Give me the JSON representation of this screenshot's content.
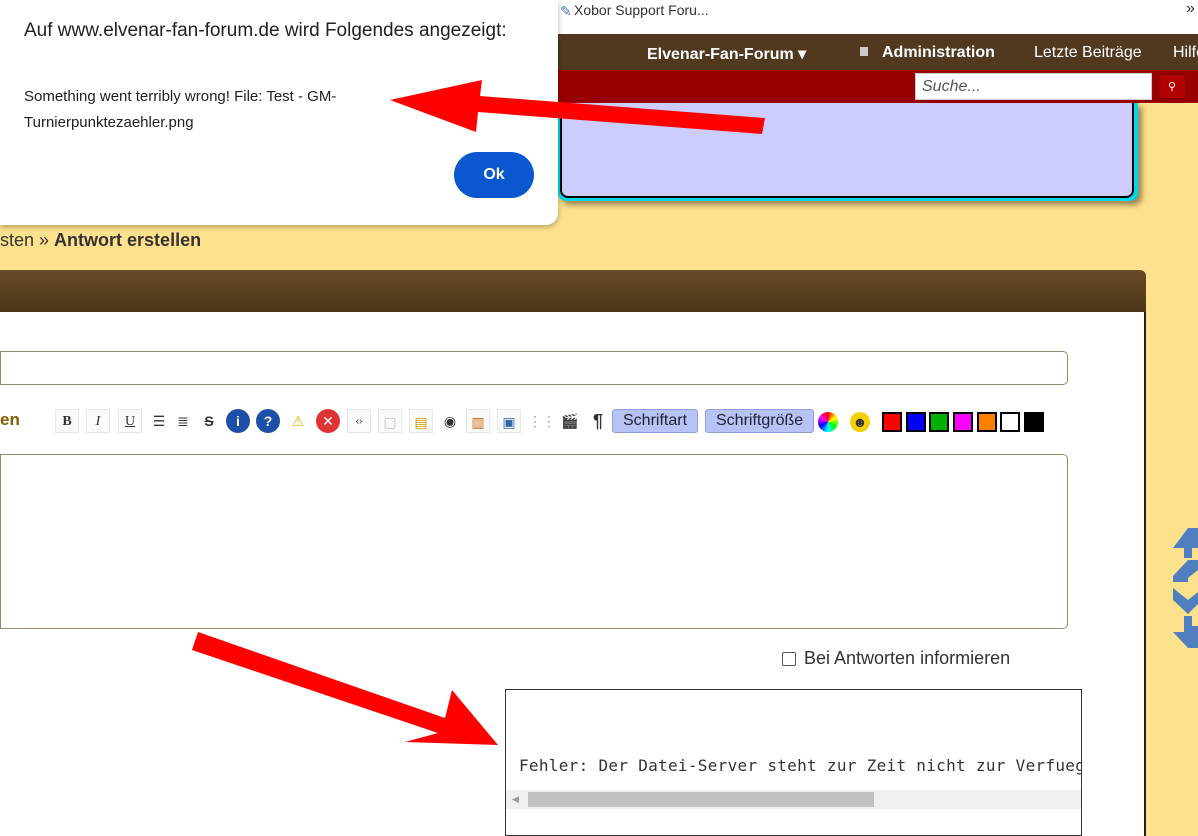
{
  "browser": {
    "tab_title": "Xobor Support Foru...",
    "overflow": "»"
  },
  "nav": {
    "items": [
      "Elvenar-Fan-Forum ▾",
      "Administration",
      "Letzte Beiträge",
      "Hilfe"
    ]
  },
  "search": {
    "placeholder": "Suche..."
  },
  "dialog": {
    "title": "Auf www.elvenar-fan-forum.de wird Folgendes angezeigt:",
    "message": "Something went terribly wrong! File: Test - GM-Turnierpunktezaehler.png",
    "ok_label": "Ok"
  },
  "breadcrumb": {
    "prev": "sten",
    "sep": " » ",
    "current": "Antwort erstellen"
  },
  "editor": {
    "toolbar_label": "en",
    "buttons": [
      "B",
      "I",
      "U"
    ],
    "font_label": "Schriftart",
    "size_label": "Schriftgröße",
    "colors": [
      "#ff0000",
      "#0000ff",
      "#00b000",
      "#ff00ff",
      "#ff8000",
      "#ffffff",
      "#000000"
    ]
  },
  "notify_label": "Bei Antworten informieren",
  "upload_frame": {
    "error": "Fehler: Der Datei-Server steht zur Zeit nicht zur Verfuegung, bitte versuchen Sie es spaeter erneut."
  },
  "colors": {
    "nav": "#50391f",
    "redbar": "#990000",
    "background": "#fee18d",
    "arrow": "#ff0000"
  }
}
